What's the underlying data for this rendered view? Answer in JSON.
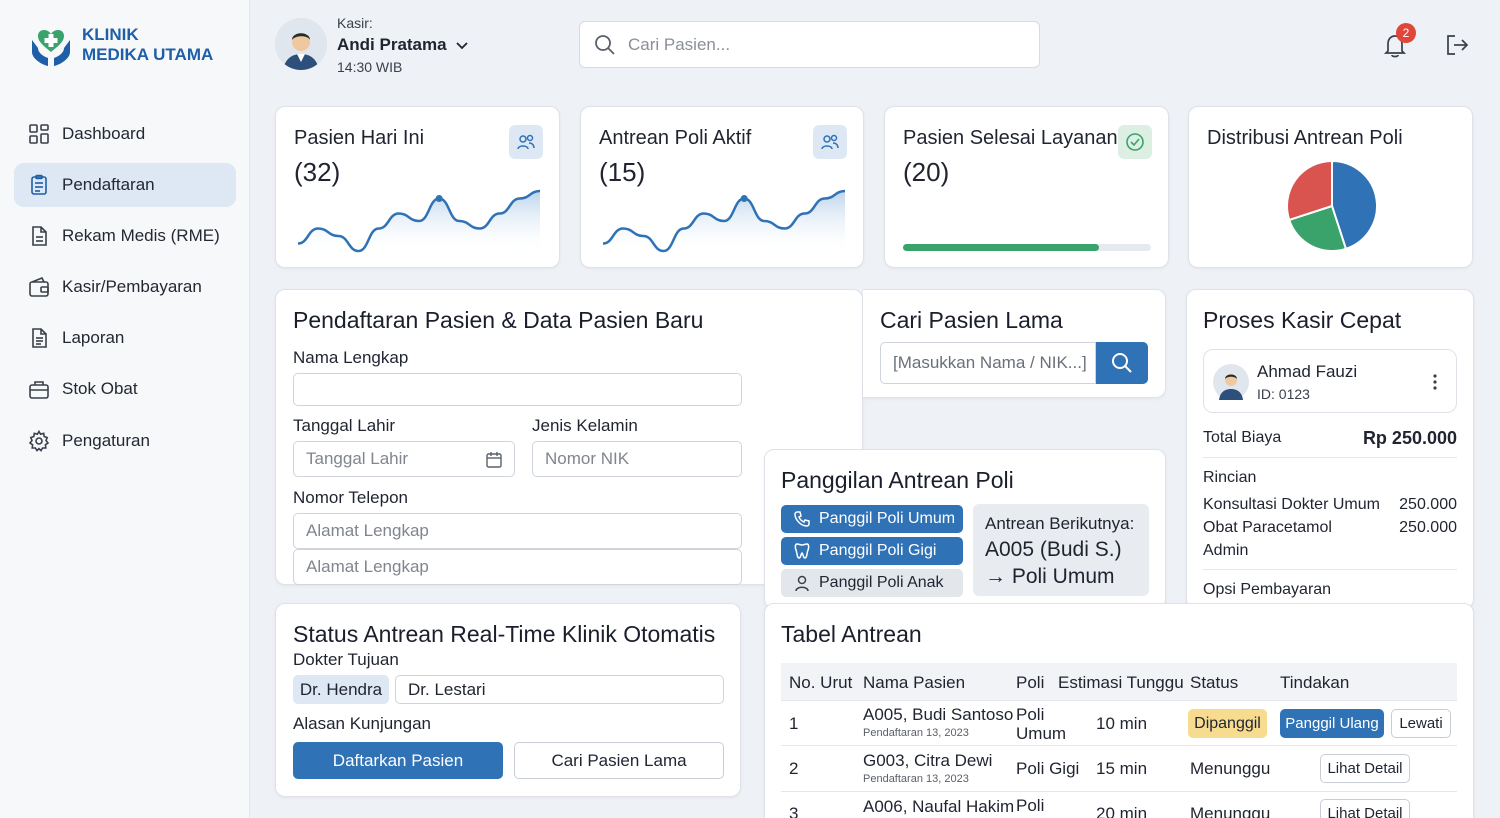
{
  "brand": {
    "line1": "KLINIK",
    "line2": "MEDIKA UTAMA"
  },
  "sidebar": {
    "items": [
      {
        "label": "Dashboard",
        "icon": "grid-icon"
      },
      {
        "label": "Pendaftaran",
        "icon": "clipboard-icon",
        "active": true
      },
      {
        "label": "Rekam Medis (RME)",
        "icon": "document-icon"
      },
      {
        "label": "Kasir/Pembayaran",
        "icon": "wallet-icon"
      },
      {
        "label": "Laporan",
        "icon": "report-icon"
      },
      {
        "label": "Stok Obat",
        "icon": "medicine-box-icon"
      },
      {
        "label": "Pengaturan",
        "icon": "gear-icon"
      }
    ]
  },
  "header": {
    "kasir_label": "Kasir:",
    "kasir_name": "Andi Pratama",
    "time": "14:30 WIB",
    "search_placeholder": "Cari Pasien...",
    "notification_count": "2"
  },
  "stats": [
    {
      "title": "Pasien Hari Ini",
      "value": "(32)"
    },
    {
      "title": "Antrean Poli Aktif",
      "value": "(15)"
    },
    {
      "title": "Pasien Selesai Layanan",
      "value": "(20)",
      "progress": 0.79
    },
    {
      "title": "Distribusi Antrean Poli"
    }
  ],
  "chart_data": [
    {
      "type": "area",
      "title": "Pasien Hari Ini",
      "values": [
        3,
        5,
        4,
        2,
        5,
        7,
        6,
        9,
        6,
        5,
        7,
        9,
        10
      ]
    },
    {
      "type": "area",
      "title": "Antrean Poli Aktif",
      "values": [
        3,
        5,
        4,
        2,
        5,
        7,
        6,
        9,
        6,
        5,
        7,
        9,
        10
      ]
    },
    {
      "type": "pie",
      "title": "Distribusi Antrean Poli",
      "values": [
        45,
        25,
        30
      ],
      "colors": [
        "#2f72b5",
        "#3aa36b",
        "#d9534f"
      ]
    }
  ],
  "registration": {
    "title": "Pendaftaran Pasien & Data Pasien Baru",
    "nama_label": "Nama Lengkap",
    "tgl_label": "Tanggal Lahir",
    "tgl_placeholder": "Tanggal Lahir",
    "jk_label": "Jenis Kelamin",
    "nik_placeholder": "Nomor NIK",
    "telp_label": "Nomor Telepon",
    "alamat1_placeholder": "Alamat Lengkap",
    "alamat2_placeholder": "Alamat Lengkap"
  },
  "search_old": {
    "title": "Cari Pasien Lama",
    "placeholder": "[Masukkan Nama / NIK...]"
  },
  "calling": {
    "title": "Panggilan Antrean Poli",
    "buttons": [
      "Panggil Poli Umum",
      "Panggil Poli Gigi",
      "Panggil Poli Anak"
    ],
    "next_label": "Antrean Berikutnya:",
    "next_number": "A005 (Budi S.)",
    "next_poli": "→ Poli Umum"
  },
  "cashier": {
    "title": "Proses Kasir Cepat",
    "patient_name": "Ahmad Fauzi",
    "patient_id": "ID: 0123",
    "total_label": "Total Biaya",
    "total_value": "Rp 250.000",
    "rincian_label": "Rincian",
    "items": [
      {
        "name": "Konsultasi Dokter Umum",
        "amount": "250.000"
      },
      {
        "name": "Obat Paracetamol",
        "amount": "250.000"
      },
      {
        "name": "Admin",
        "amount": ""
      }
    ],
    "payment_label": "Opsi Pembayaran"
  },
  "status_queue": {
    "title": "Status Antrean Real-Time Klinik Otomatis",
    "doctor_label": "Dokter Tujuan",
    "doctor_a": "Dr. Hendra",
    "doctor_b": "Dr. Lestari",
    "reason_label": "Alasan Kunjungan",
    "register_btn": "Daftarkan Pasien",
    "search_btn": "Cari Pasien Lama"
  },
  "queue_table": {
    "title": "Tabel Antrean",
    "headers": [
      "No. Urut",
      "Nama Pasien",
      "Poli",
      "Estimasi Tunggu",
      "Status",
      "Tindakan"
    ],
    "rows": [
      {
        "no": "1",
        "name": "A005, Budi Santoso",
        "sub": "Pendaftaran 13, 2023",
        "poli": "Poli Umum",
        "wait": "10 min",
        "status": "Dipanggil",
        "action1": "Panggil Ulang",
        "action2": "Lewati"
      },
      {
        "no": "2",
        "name": "G003, Citra Dewi",
        "sub": "Pendaftaran 13, 2023",
        "poli": "Poli Gigi",
        "wait": "15 min",
        "status": "Menunggu",
        "action1": "Lihat Detail"
      },
      {
        "no": "3",
        "name": "A006, Naufal Hakim",
        "sub": "",
        "poli": "Poli Umum",
        "wait": "20 min",
        "status": "Menunggu",
        "action1": "Lihat Detail"
      }
    ]
  }
}
